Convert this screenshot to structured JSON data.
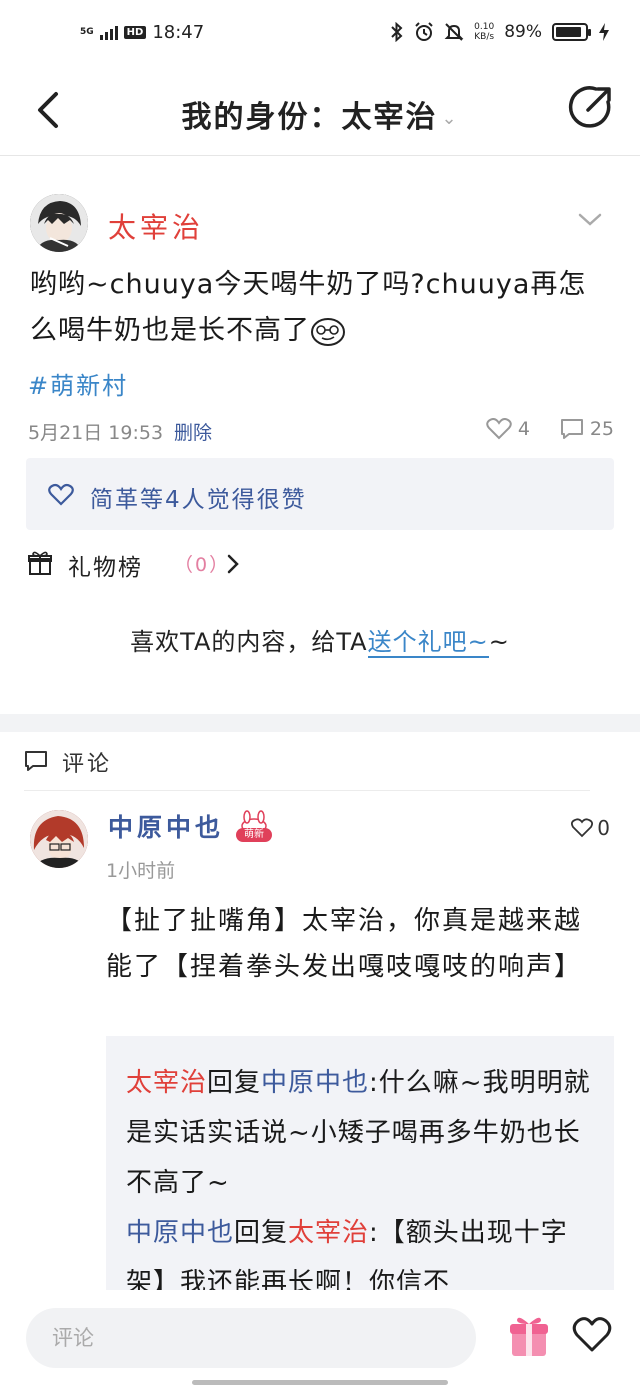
{
  "status_bar": {
    "network": "5G",
    "hd": "HD",
    "time": "18:47",
    "net_speed_top": "0.10",
    "net_speed_unit": "KB/s",
    "battery": "89%",
    "battery_level": 0.89
  },
  "nav": {
    "title": "我的身份：太宰治",
    "chevron": "⌄"
  },
  "post": {
    "author": "太宰治",
    "text": "哟哟~chuuya今天喝牛奶了吗?chuuya再怎么喝牛奶也是长不高了",
    "topic": "#萌新村",
    "date": "5月21日 19:53",
    "delete_label": "删除",
    "like_count": "4",
    "comment_count": "25",
    "liked_by": "简革等4人觉得很赞"
  },
  "gifts": {
    "label": "礼物榜",
    "count": "（0）",
    "prompt": "喜欢TA的内容，给TA",
    "link": "送个礼吧~",
    "suffix": "~"
  },
  "comments": {
    "header": "评论",
    "items": [
      {
        "author": "中原中也",
        "badge": "萌新",
        "time": "1小时前",
        "likes": "0",
        "text": "【扯了扯嘴角】太宰治，你真是越来越能了【捏着拳头发出嘎吱嘎吱的响声】",
        "replies": [
          {
            "from": "太宰治",
            "reply_word": "回复",
            "to": "中原中也",
            "text": ":什么嘛~我明明就是实话实话说~小矮子喝再多牛奶也长不高了~"
          },
          {
            "from": "中原中也",
            "reply_word": "回复",
            "to": "太宰治",
            "text": ":【额头出现十字架】我还能再长啊！你信不"
          }
        ]
      }
    ]
  },
  "bottom_bar": {
    "input_placeholder": "评论"
  }
}
